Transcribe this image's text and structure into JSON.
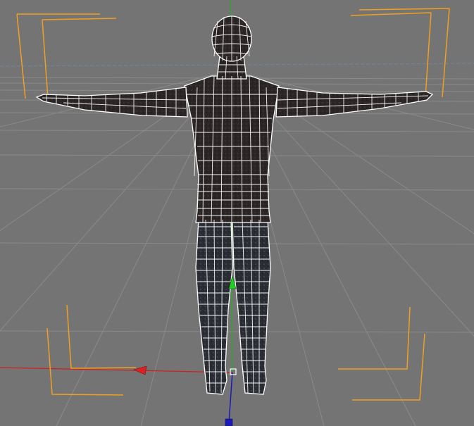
{
  "viewport": {
    "view": "perspective",
    "background_color": "#747474",
    "grid": true,
    "grid_color": "#8a8a8a",
    "horizon_color": "#6f86a0",
    "selection_bracket_color": "#f0a020",
    "axis_colors": {
      "x": "#e02020",
      "y": "#20c020",
      "z": "#1a1ab8"
    },
    "object": {
      "type": "humanoid-mesh",
      "display": "wireframe-on-shaded",
      "surface_color": "#2a2424",
      "wire_color": "#ffffff",
      "pose": "t-pose"
    },
    "gizmo": {
      "mode": "move",
      "visible_axes": [
        "x",
        "y",
        "z"
      ]
    }
  }
}
